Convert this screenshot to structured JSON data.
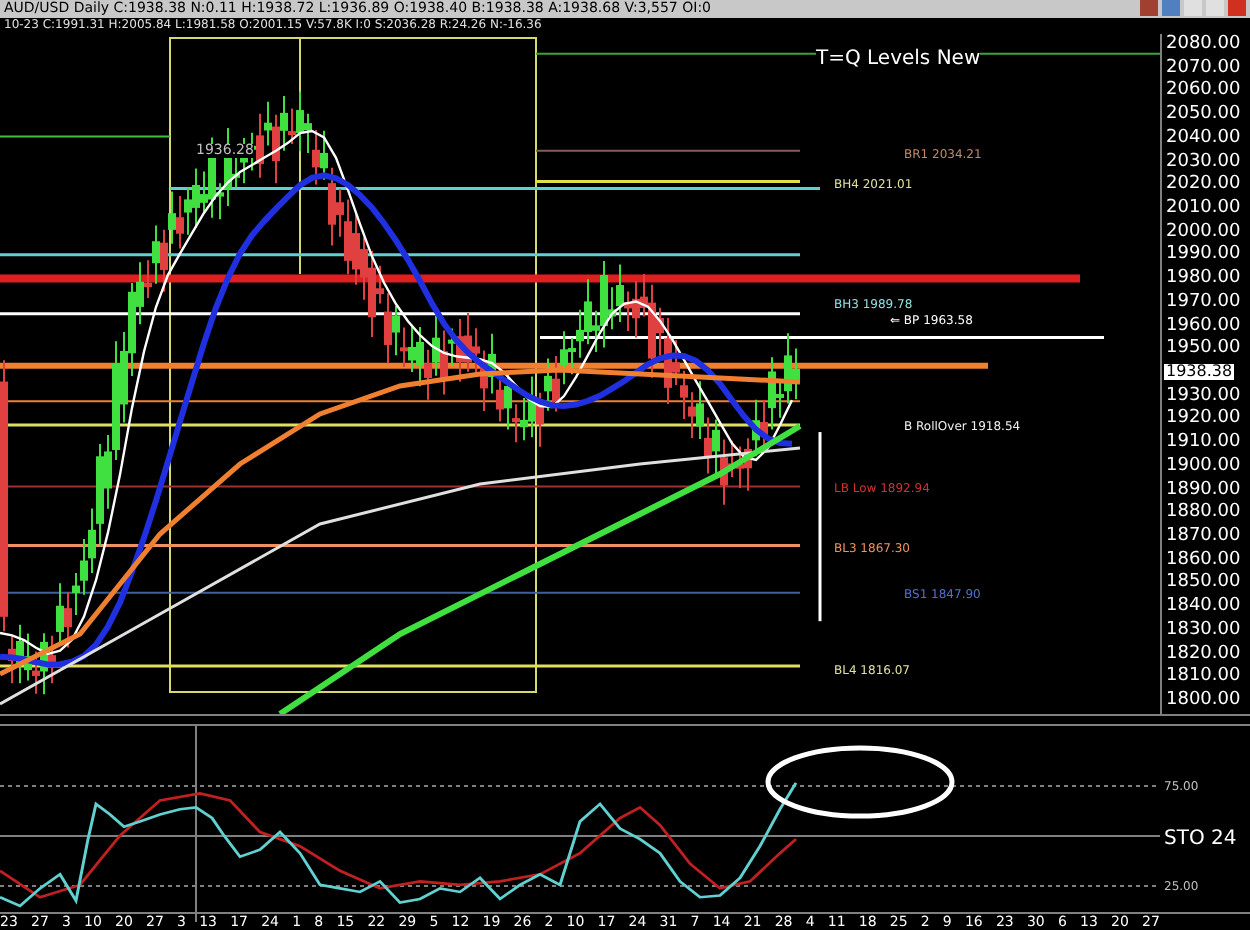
{
  "header": "AUD/USD Daily C:1938.38 N:0.11 H:1938.72 L:1936.89 O:1938.40 B:1938.38 A:1938.68 V:3,557 OI:0",
  "subheader": "10-23 C:1991.31 H:2005.84 L:1981.58 O:2001.15 V:57.8K I:0 S:2036.28 R:24.26 N:-16.36",
  "chart": {
    "title": "T=Q Levels New",
    "price_note": "1936.28",
    "levels": [
      {
        "text": "BR1 2034.21",
        "color": "#c08a6a"
      },
      {
        "text": "BH4 2021.01",
        "color": "#e0e0a0"
      },
      {
        "text": "BH3 1989.78",
        "color": "#90e0e0"
      },
      {
        "text": "⇐ BP 1963.58",
        "color": "#ffffff"
      },
      {
        "text": "B RollOver 1918.54",
        "color": "#f0f0f0"
      },
      {
        "text": "LB Low 1892.94",
        "color": "#d03030"
      },
      {
        "text": "BL3 1867.30",
        "color": "#f09060"
      },
      {
        "text": "BS1 1847.90",
        "color": "#5070d0"
      },
      {
        "text": "BL4 1816.07",
        "color": "#e0e0a0"
      }
    ],
    "price_axis": [
      "2080.00",
      "2070.00",
      "2060.00",
      "2050.00",
      "2040.00",
      "2030.00",
      "2020.00",
      "2010.00",
      "2000.00",
      "1990.00",
      "1980.00",
      "1970.00",
      "1960.00",
      "1950.00",
      "1930.00",
      "1920.00",
      "1910.00",
      "1900.00",
      "1890.00",
      "1880.00",
      "1870.00",
      "1860.00",
      "1850.00",
      "1840.00",
      "1830.00",
      "1820.00",
      "1810.00",
      "1800.00"
    ],
    "current_price": "1938.38"
  },
  "stochastic": {
    "label": "STO 24",
    "upper": "75.00",
    "lower": "25.00"
  },
  "time_axis": [
    "23",
    "27",
    "3",
    "10",
    "20",
    "27",
    "3",
    "13",
    "17",
    "24",
    "1",
    "8",
    "15",
    "22",
    "29",
    "5",
    "12",
    "19",
    "26",
    "2",
    "10",
    "17",
    "24",
    "31",
    "7",
    "14",
    "21",
    "28",
    "4",
    "11",
    "18",
    "25",
    "2",
    "9",
    "16",
    "23",
    "30",
    "6",
    "13",
    "20",
    "27"
  ]
}
